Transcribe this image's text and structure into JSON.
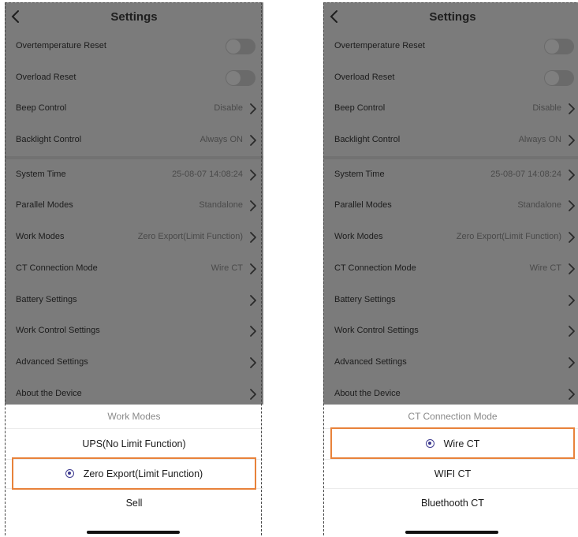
{
  "left": {
    "header": {
      "title": "Settings"
    },
    "rows": [
      {
        "label": "Overtemperature Reset",
        "value": "",
        "kind": "toggle"
      },
      {
        "label": "Overload Reset",
        "value": "",
        "kind": "toggle"
      },
      {
        "label": "Beep Control",
        "value": "Disable",
        "kind": "chevron"
      },
      {
        "label": "Backlight Control",
        "value": "Always ON",
        "kind": "chevron"
      },
      {
        "label": "System Time",
        "value": "25-08-07 14:08:24",
        "kind": "chevron"
      },
      {
        "label": "Parallel Modes",
        "value": "Standalone",
        "kind": "chevron"
      },
      {
        "label": "Work Modes",
        "value": "Zero Export(Limit Function)",
        "kind": "chevron"
      },
      {
        "label": "CT Connection Mode",
        "value": "Wire CT",
        "kind": "chevron"
      },
      {
        "label": "Battery Settings",
        "value": "",
        "kind": "chevron"
      },
      {
        "label": "Work Control Settings",
        "value": "",
        "kind": "chevron"
      },
      {
        "label": "Advanced Settings",
        "value": "",
        "kind": "chevron"
      },
      {
        "label": "About the Device",
        "value": "",
        "kind": "chevron"
      }
    ],
    "sheet": {
      "title": "Work Modes",
      "options": [
        {
          "label": "UPS(No Limit Function)",
          "selected": false
        },
        {
          "label": "Zero Export(Limit Function)",
          "selected": true
        },
        {
          "label": "Sell",
          "selected": false
        }
      ]
    }
  },
  "right": {
    "header": {
      "title": "Settings"
    },
    "rows": [
      {
        "label": "Overtemperature Reset",
        "value": "",
        "kind": "toggle"
      },
      {
        "label": "Overload Reset",
        "value": "",
        "kind": "toggle"
      },
      {
        "label": "Beep Control",
        "value": "Disable",
        "kind": "chevron"
      },
      {
        "label": "Backlight Control",
        "value": "Always ON",
        "kind": "chevron"
      },
      {
        "label": "System Time",
        "value": "25-08-07 14:08:24",
        "kind": "chevron"
      },
      {
        "label": "Parallel Modes",
        "value": "Standalone",
        "kind": "chevron"
      },
      {
        "label": "Work Modes",
        "value": "Zero Export(Limit Function)",
        "kind": "chevron"
      },
      {
        "label": "CT Connection Mode",
        "value": "Wire CT",
        "kind": "chevron"
      },
      {
        "label": "Battery Settings",
        "value": "",
        "kind": "chevron"
      },
      {
        "label": "Work Control Settings",
        "value": "",
        "kind": "chevron"
      },
      {
        "label": "Advanced Settings",
        "value": "",
        "kind": "chevron"
      },
      {
        "label": "About the Device",
        "value": "",
        "kind": "chevron"
      }
    ],
    "sheet": {
      "title": "CT Connection Mode",
      "options": [
        {
          "label": "Wire CT",
          "selected": true
        },
        {
          "label": "WIFI CT",
          "selected": false
        },
        {
          "label": "Bluethooth CT",
          "selected": false
        }
      ]
    }
  },
  "colors": {
    "highlight": "#e8823a",
    "radio": "#3d3a8f",
    "overlay": "#7b7b7b"
  }
}
